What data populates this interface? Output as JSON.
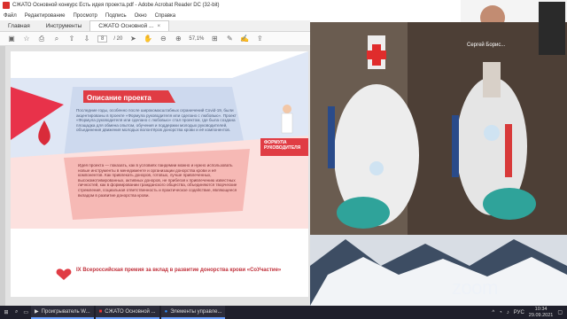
{
  "window": {
    "title": "СЖАТО Основной конкурс Есть идея проекта.pdf - Adobe Acrobat Reader DC (32-bit)"
  },
  "menu": [
    "Файл",
    "Редактирование",
    "Просмотр",
    "Подпись",
    "Окно",
    "Справка"
  ],
  "tabs": [
    {
      "label": "Главная"
    },
    {
      "label": "Инструменты"
    },
    {
      "label": "СЖАТО Основной ..."
    }
  ],
  "toolbar": {
    "page_current": "8",
    "page_total": "/ 20",
    "zoom": "57,1%"
  },
  "slide": {
    "header": "Описание проекта",
    "para1": "Последние годы, особенно после широкомасштабных ограничений Covid-19, были акцентированы в проекте «Формула руководителя или сделано с любовью». Проект «Формула руководителя или сделано с любовью» стал проектом, где была создана площадка для обмена опытом, обучения и поддержки молодых руководителей, объединения движения молодых волонтёров донорства крови и её компонентов.",
    "para2": "Идея проекта — показать, как в условиях пандемии можно и нужно использовать новые инструменты в менеджменте и организации донорства крови и её компонентов. Как привлекать доноров, готовых, лучше привлеченных, высокомотивированных, активных доноров, не прибегая к привлечению известных личностей, как в формировании гражданского общества, объединяются творческие стремления, социальная ответственность и практическое содействие, являющееся вкладом в развитие донорства крови.",
    "badge_line1": "ФОРМУЛА",
    "badge_line2": "РУКОВОДИТЕЛЯ",
    "footer": "IX Всероссийская премия за вклад в развитие донорства крови «СоУчастие»"
  },
  "webcam": {
    "name": "Сергей Борис..."
  },
  "zoom_watermark": "zoom",
  "taskbar": {
    "items": [
      {
        "label": "Проигрыватель W..."
      },
      {
        "label": "СЖАТО Основной ..."
      },
      {
        "label": "Элементы управле..."
      }
    ],
    "language": "РУС",
    "time": "10:34",
    "date": "29.09.2021"
  },
  "colors": {
    "accent_red": "#e03c44",
    "slide_blue": "#cdd9ee",
    "slide_pink": "#f6b9b5",
    "zoom_blue": "#2d8cff"
  }
}
